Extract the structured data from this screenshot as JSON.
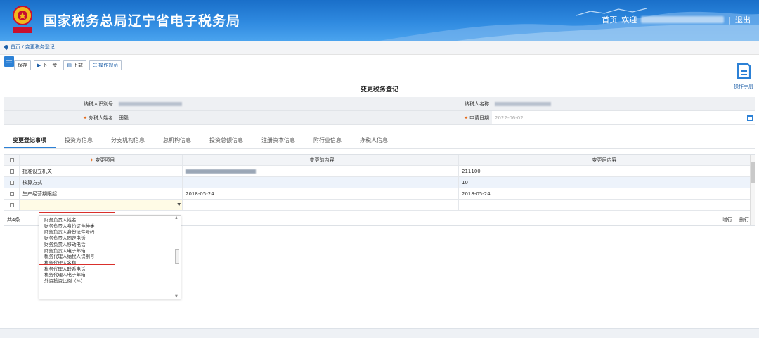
{
  "header": {
    "site_title": "国家税务总局辽宁省电子税务局",
    "emblem_text": "中国税务",
    "home_label": "首页",
    "welcome_label": "欢迎",
    "separator": "|",
    "logout_label": "退出"
  },
  "breadcrumb": {
    "text": "首页 / 变更税务登记"
  },
  "toolbar": {
    "menu_icon": "☰",
    "save_label": "保存",
    "next_label": "下一步",
    "download_label": "下载",
    "guide_label": "操作规范",
    "manual_label": "操作手册"
  },
  "form": {
    "title": "变更税务登记",
    "taxpayer_id_label": "纳税人识别号",
    "taxpayer_name_label": "纳税人名称",
    "agent_name_label": "办税人姓名",
    "agent_name_value": "田毅",
    "apply_date_label": "申请日期",
    "apply_date_value": "2022-06-02"
  },
  "tabs": [
    {
      "label": "变更登记事项"
    },
    {
      "label": "投资方信息"
    },
    {
      "label": "分支机构信息"
    },
    {
      "label": "总机构信息"
    },
    {
      "label": "投资总额信息"
    },
    {
      "label": "注册资本信息"
    },
    {
      "label": "附行业信息"
    },
    {
      "label": "办税人信息"
    }
  ],
  "grid": {
    "headers": {
      "item": "变更项目",
      "before": "变更前内容",
      "after": "变更后内容"
    },
    "rows": [
      {
        "item": "批准设立机关",
        "before": "",
        "after": "211100"
      },
      {
        "item": "核算方式",
        "before": "",
        "after": "10"
      },
      {
        "item": "生产经营期限起",
        "before": "2018-05-24",
        "after": "2018-05-24"
      },
      {
        "item": "",
        "before": "",
        "after": ""
      }
    ],
    "count_label": "共4条",
    "add_row_label": "增行",
    "delete_row_label": "删行"
  },
  "dropdown": {
    "items": [
      "财务负责人姓名",
      "财务负责人身份证件种类",
      "财务负责人身份证件号码",
      "财务负责人固定电话",
      "财务负责人移动电话",
      "财务负责人电子邮箱",
      "税务代理人纳税人识别号",
      "税务代理人名称",
      "税务代理人联系电话",
      "税务代理人电子邮箱",
      "外资投资比例（%）"
    ]
  },
  "colors": {
    "header_blue": "#2f8ae0",
    "link_blue": "#1d5fa8",
    "required_orange": "#e56b1a",
    "highlight_red": "#d9302c"
  }
}
